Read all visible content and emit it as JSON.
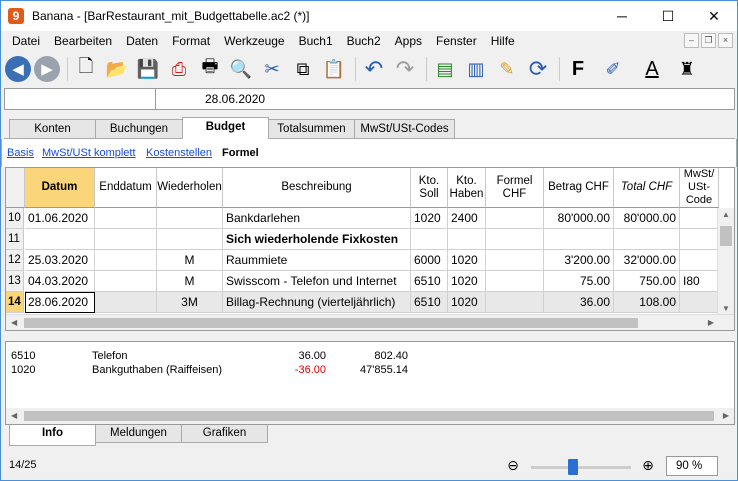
{
  "window": {
    "title": "Banana - [BarRestaurant_mit_Budgettabelle.ac2 (*)]",
    "app_icon": "9",
    "minimize": "─",
    "maximize": "☐",
    "close": "✕"
  },
  "menu": [
    "Datei",
    "Bearbeiten",
    "Daten",
    "Format",
    "Werkzeuge",
    "Buch1",
    "Buch2",
    "Apps",
    "Fenster",
    "Hilfe"
  ],
  "mdi": {
    "minimize": "–",
    "restore": "❐",
    "close": "×"
  },
  "toolbar": {
    "icons": [
      "back-icon",
      "forward-icon",
      "new-file-icon",
      "open-folder-icon",
      "save-icon",
      "pdf-icon",
      "print-icon",
      "print-preview-icon",
      "cut-icon",
      "copy-icon",
      "paste-icon",
      "undo-icon",
      "redo-icon",
      "insert-row-icon",
      "delete-row-icon",
      "edit-icon",
      "recalculate-icon",
      "bold-icon",
      "highlight-icon",
      "font-color-icon",
      "castle-icon"
    ],
    "glyphs": {
      "back": "◀",
      "forward": "▶",
      "new": "🗋",
      "open": "📂",
      "save": "💾",
      "pdf": "⎙",
      "print": "🖶",
      "preview": "🔍",
      "cut": "✂",
      "copy": "⧉",
      "paste": "📋",
      "undo": "↶",
      "redo": "↷",
      "insert_row": "▤",
      "delete_row": "▥",
      "edit": "✎",
      "recalc": "⟳",
      "bold": "F",
      "highlight": "✐",
      "font_color": "A",
      "castle": "♜"
    }
  },
  "cellbar": {
    "value": "28.06.2020"
  },
  "tabs": [
    "Konten",
    "Buchungen",
    "Budget",
    "Totalsummen",
    "MwSt/USt-Codes"
  ],
  "views": [
    "Basis",
    "MwSt/USt komplett",
    "Kostenstellen",
    "Formel"
  ],
  "columns": [
    "Datum",
    "Enddatum",
    "Wiederholen",
    "Beschreibung",
    "Kto. Soll",
    "Kto. Haben",
    "Formel CHF",
    "Betrag CHF",
    "Total CHF",
    "MwSt/ USt- Code"
  ],
  "rows": [
    {
      "n": "10",
      "datum": "01.06.2020",
      "enddatum": "",
      "wiederholen": "",
      "beschreibung": "Bankdarlehen",
      "soll": "1020",
      "haben": "2400",
      "formel": "",
      "betrag": "80'000.00",
      "total": "80'000.00",
      "code": ""
    },
    {
      "n": "11",
      "datum": "",
      "enddatum": "",
      "wiederholen": "",
      "beschreibung": "Sich wiederholende Fixkosten",
      "soll": "",
      "haben": "",
      "formel": "",
      "betrag": "",
      "total": "",
      "code": ""
    },
    {
      "n": "12",
      "datum": "25.03.2020",
      "enddatum": "",
      "wiederholen": "M",
      "beschreibung": "Raummiete",
      "soll": "6000",
      "haben": "1020",
      "formel": "",
      "betrag": "3'200.00",
      "total": "32'000.00",
      "code": ""
    },
    {
      "n": "13",
      "datum": "04.03.2020",
      "enddatum": "",
      "wiederholen": "M",
      "beschreibung": "Swisscom - Telefon und Internet",
      "soll": "6510",
      "haben": "1020",
      "formel": "",
      "betrag": "75.00",
      "total": "750.00",
      "code": "I80"
    },
    {
      "n": "14",
      "datum": "28.06.2020",
      "enddatum": "",
      "wiederholen": "3M",
      "beschreibung": "Billag-Rechnung (vierteljährlich)",
      "soll": "6510",
      "haben": "1020",
      "formel": "",
      "betrag": "36.00",
      "total": "108.00",
      "code": ""
    }
  ],
  "info": [
    {
      "account": "6510",
      "name": "Telefon",
      "amount": "36.00",
      "balance": "802.40"
    },
    {
      "account": "1020",
      "name": "Bankguthaben (Raiffeisen)",
      "amount": "-36.00",
      "balance": "47'855.14"
    }
  ],
  "bottom_tabs": [
    "Info",
    "Meldungen",
    "Grafiken"
  ],
  "status": {
    "position": "14/25",
    "zoom": "90 %",
    "zoom_out": "⊖",
    "zoom_in": "⊕"
  },
  "colors": {
    "header_highlight": "#fbd57a",
    "negative": "#dd0000",
    "link": "#1a4bd6"
  }
}
